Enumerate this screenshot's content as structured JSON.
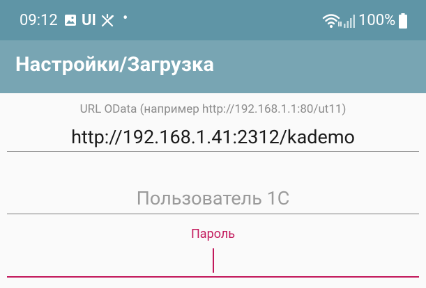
{
  "status_bar": {
    "time": "09:12",
    "app_indicator": "UI",
    "dot": "•",
    "battery_text": "100%",
    "icons": [
      "image-icon",
      "satellite-off-icon",
      "wifi-icon",
      "signal-icon",
      "battery-icon"
    ]
  },
  "app_bar": {
    "title": "Настройки/Загрузка"
  },
  "form": {
    "url_hint": "URL OData (например http://192.168.1.1:80/ut11)",
    "url_value": "http://192.168.1.41:2312/kademo",
    "user_placeholder": "Пользователь 1С",
    "password_label": "Пароль"
  },
  "colors": {
    "status_bar": "#5f95a6",
    "app_bar": "#78a5b3",
    "accent": "#c2185b"
  }
}
